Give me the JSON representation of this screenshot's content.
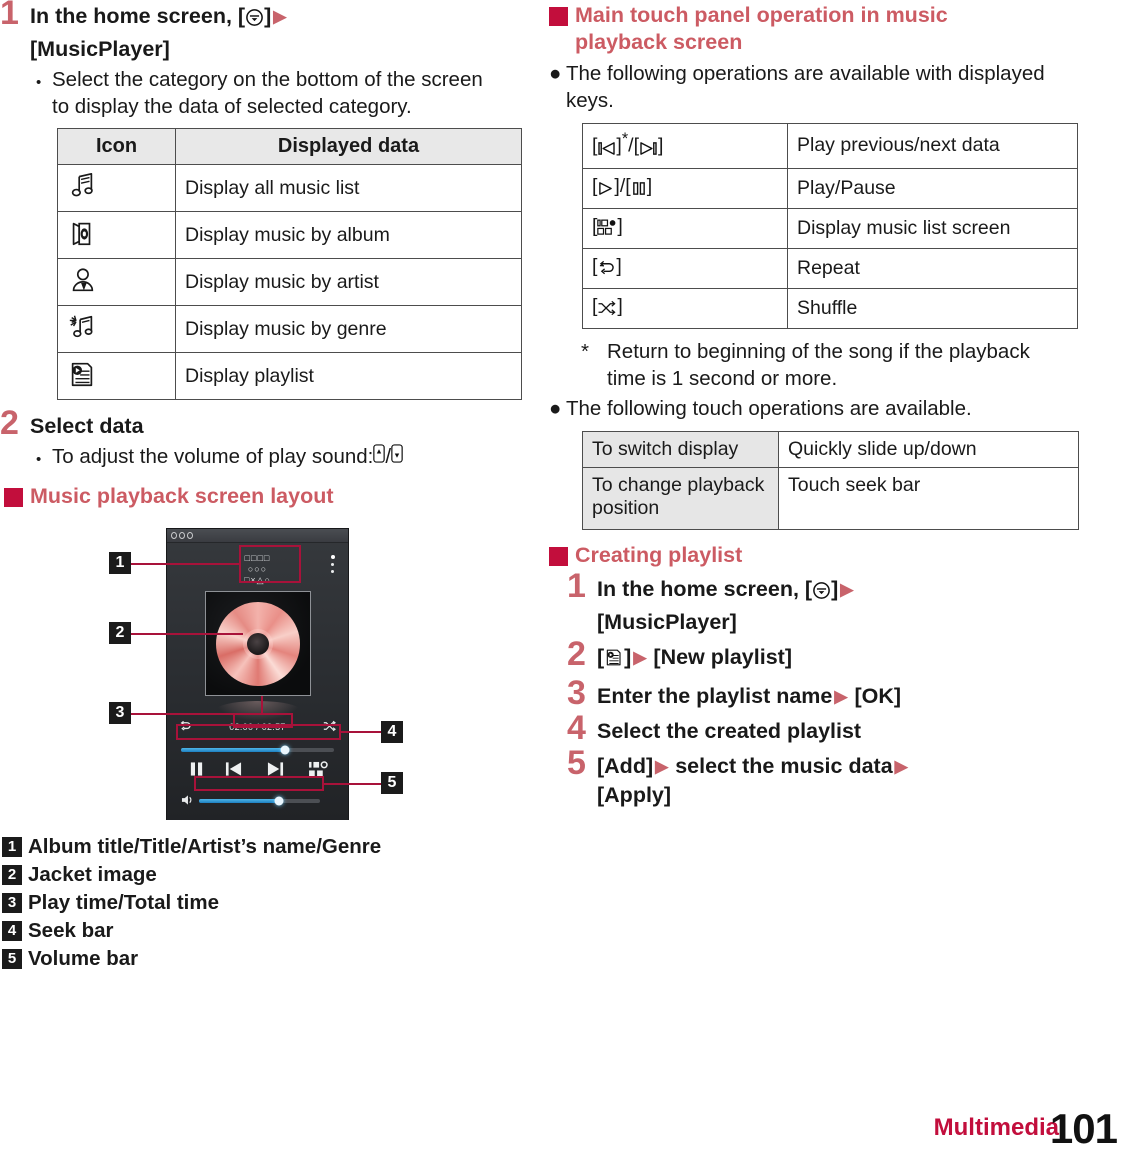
{
  "left": {
    "step1": {
      "num": "1",
      "text_a": "In the home screen, [",
      "key": "home-select-key",
      "text_b": "]",
      "line2": "[MusicPlayer]",
      "bullet": "Select the category on the bottom of the screen to display the data of selected category."
    },
    "icon_table": {
      "headers": [
        "Icon",
        "Displayed data"
      ],
      "rows": [
        {
          "icon": "all-music-note-icon",
          "label": "Display all music list"
        },
        {
          "icon": "album-icon",
          "label": "Display music by album"
        },
        {
          "icon": "artist-icon",
          "label": "Display music by artist"
        },
        {
          "icon": "genre-icon",
          "label": "Display music by genre"
        },
        {
          "icon": "playlist-icon",
          "label": "Display playlist"
        }
      ]
    },
    "step2": {
      "num": "2",
      "title": "Select data",
      "bullet_text": "To adjust the volume of play sound: ",
      "bullet_keys": "volume-up-key / volume-down-key"
    },
    "section_layout": {
      "title": "Music playback screen layout"
    },
    "phone": {
      "meta_line1": "□□□□",
      "meta_line2": "○○○",
      "meta_line3": "□×△○",
      "time": "02:00 / 02:57",
      "seek_percent": 68,
      "volume_percent": 66,
      "callouts": [
        "1",
        "2",
        "3",
        "4",
        "5"
      ]
    },
    "legend": [
      {
        "num": "1",
        "label": "Album title/Title/Artist’s name/Genre"
      },
      {
        "num": "2",
        "label": "Jacket image"
      },
      {
        "num": "3",
        "label": "Play time/Total time"
      },
      {
        "num": "4",
        "label": "Seek bar"
      },
      {
        "num": "5",
        "label": "Volume bar"
      }
    ]
  },
  "right": {
    "section_main": {
      "title_line1": "Main touch panel operation in music",
      "title_line2": "playback screen"
    },
    "bullet_keys": "The following operations are available with displayed keys.",
    "key_table": {
      "rows": [
        {
          "keys": "prev-next-keys",
          "label": "Play previous/next data"
        },
        {
          "keys": "play-pause-keys",
          "label": "Play/Pause"
        },
        {
          "keys": "music-list-key",
          "label": "Display music list screen"
        },
        {
          "keys": "repeat-key",
          "label": "Repeat"
        },
        {
          "keys": "shuffle-key",
          "label": "Shuffle"
        }
      ]
    },
    "footnote": {
      "mark": "*",
      "text": "Return to beginning of the song if the playback time is 1 second or more."
    },
    "bullet_touch": "The following touch operations are available.",
    "touch_table": {
      "rows": [
        {
          "action": "To switch display",
          "result": "Quickly slide up/down"
        },
        {
          "action": "To change playback position",
          "result": "Touch seek bar"
        }
      ]
    },
    "section_playlist": {
      "title": "Creating playlist"
    },
    "playlist_steps": [
      {
        "num": "1",
        "line1_a": "In the home screen, [",
        "line1_key": "home-select-key",
        "line1_b": "]",
        "line2": "[MusicPlayer]"
      },
      {
        "num": "2",
        "pre": "[",
        "key": "playlist-icon",
        "post": "]",
        "tail": "[New playlist]"
      },
      {
        "num": "3",
        "a": "Enter the playlist name",
        "b": "[OK]"
      },
      {
        "num": "4",
        "a": "Select the created playlist",
        "b": ""
      },
      {
        "num": "5",
        "a": "[Add]",
        "b": "select the music data",
        "c": "[Apply]"
      }
    ]
  },
  "footer": {
    "chapter": "Multimedia",
    "page": "101"
  },
  "colors": {
    "accent_square": "#C20E3C",
    "accent_heading": "#CC5B63",
    "step_number": "#C8636B",
    "callout_red": "#A8123A",
    "table_border": "#4d4d4d",
    "table_header_bg": "#e8e8e8"
  }
}
